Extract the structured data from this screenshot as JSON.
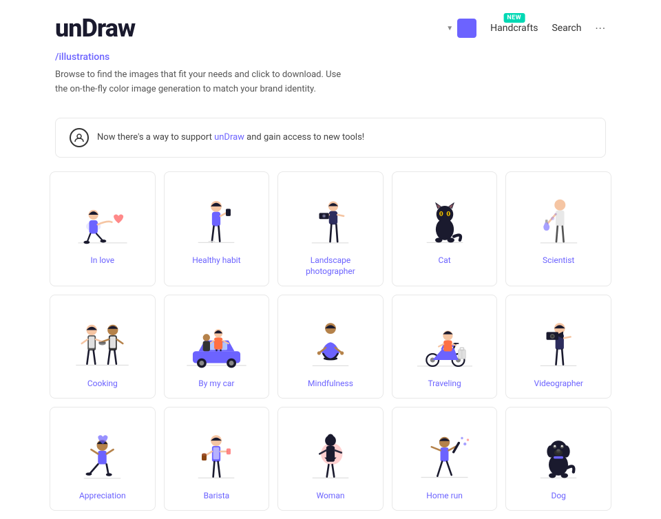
{
  "header": {
    "logo": "unDraw",
    "nav": {
      "handcrafts_label": "Handcrafts",
      "handcrafts_badge": "NEW",
      "search_label": "Search",
      "more_label": "···"
    },
    "color_value": "#6c63ff"
  },
  "subtitle": {
    "link_text": "/illustrations",
    "description_line1": "Browse to find the images that fit your needs and click to download. Use",
    "description_line2": "the on-the-fly color image generation to match your brand identity."
  },
  "banner": {
    "text_plain": "Now there's a way to support unDraw and gain access to new tools!"
  },
  "grid": {
    "rows": [
      [
        {
          "label": "In love",
          "key": "in-love"
        },
        {
          "label": "Healthy habit",
          "key": "healthy-habit"
        },
        {
          "label": "Landscape photographer",
          "key": "landscape-photographer"
        },
        {
          "label": "Cat",
          "key": "cat"
        },
        {
          "label": "Scientist",
          "key": "scientist"
        }
      ],
      [
        {
          "label": "Cooking",
          "key": "cooking"
        },
        {
          "label": "By my car",
          "key": "by-my-car"
        },
        {
          "label": "Mindfulness",
          "key": "mindfulness"
        },
        {
          "label": "Traveling",
          "key": "traveling"
        },
        {
          "label": "Videographer",
          "key": "videographer"
        }
      ],
      [
        {
          "label": "Appreciation",
          "key": "appreciation"
        },
        {
          "label": "Barista",
          "key": "barista"
        },
        {
          "label": "Woman",
          "key": "woman"
        },
        {
          "label": "Home run",
          "key": "home-run"
        },
        {
          "label": "Dog",
          "key": "dog"
        }
      ]
    ]
  }
}
